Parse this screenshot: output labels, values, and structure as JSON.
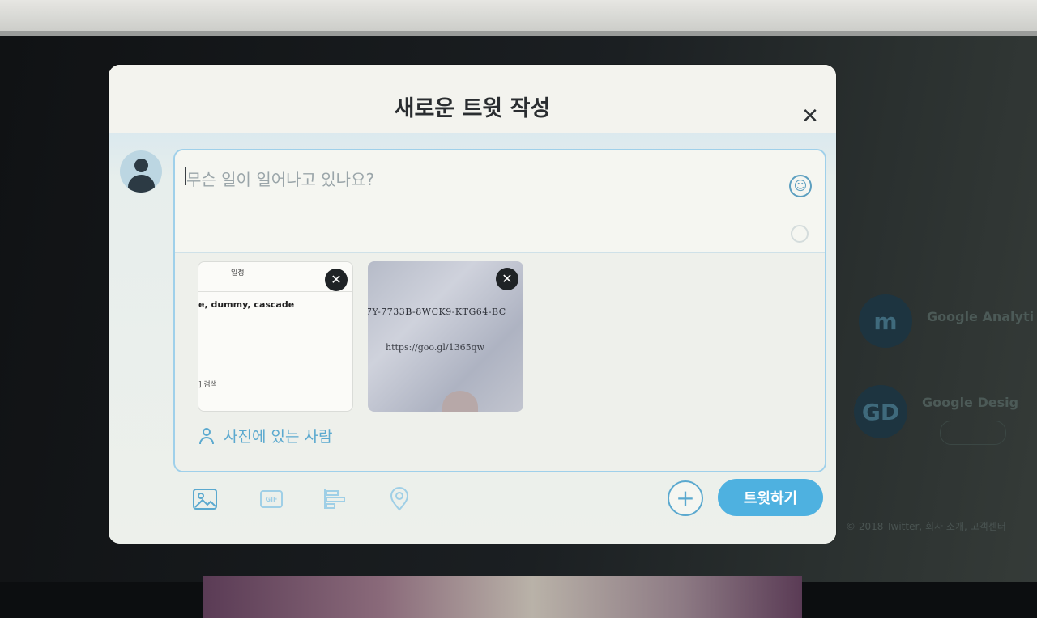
{
  "modal": {
    "title": "새로운 트윗 작성",
    "close_icon": "close-icon",
    "compose": {
      "placeholder": "무슨 일이 일어나고 있나요?",
      "emoji_icon": "emoji-smiley-icon"
    },
    "media": [
      {
        "lines": [
          "일정",
          "e, dummy, cascade",
          "] 검색"
        ]
      },
      {
        "lines": [
          "7Y-7733B-8WCK9-KTG64-BC",
          "https://goo.gl/1365qw"
        ]
      }
    ],
    "tag_people_label": "사진에 있는 사람",
    "toolbar": {
      "image_icon": "image-icon",
      "gif_label": "GIF",
      "poll_icon": "poll-icon",
      "location_icon": "location-icon",
      "add_label": "+",
      "tweet_label": "트윗하기"
    }
  },
  "background": {
    "suggestions": [
      {
        "avatar_label": "m",
        "name": "Google Analyti"
      },
      {
        "avatar_label": "GD",
        "name": "Google Desig"
      }
    ],
    "footer_text": "© 2018 Twitter, 회사 소개, 고객센터"
  },
  "colors": {
    "accent": "#4eb1e0",
    "modal_bg": "#f1f2ec",
    "border_focus": "#9fd0ea"
  }
}
